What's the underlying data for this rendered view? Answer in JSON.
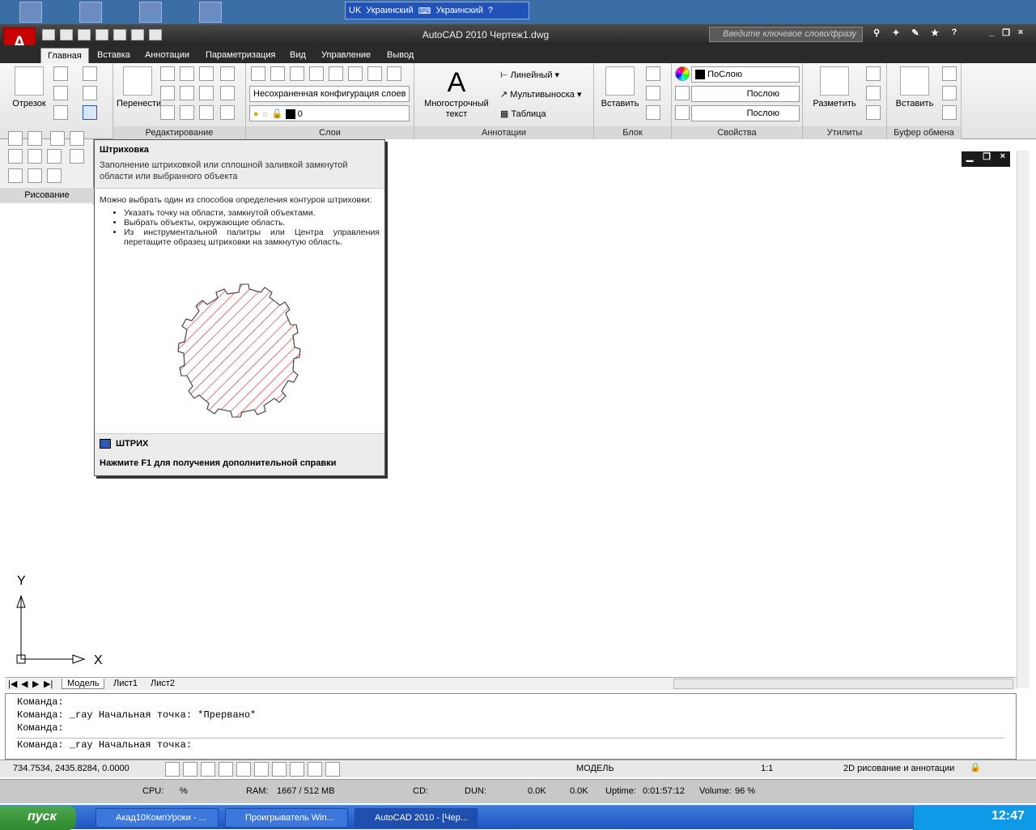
{
  "desktop": {
    "lang_indicator": "UK",
    "lang1": "Украинский",
    "lang2": "Украинский"
  },
  "window": {
    "title": "AutoCAD 2010 Чертеж1.dwg",
    "search_placeholder": "Введите ключевое слово/фразу"
  },
  "tabs": [
    "Главная",
    "Вставка",
    "Аннотации",
    "Параметризация",
    "Вид",
    "Управление",
    "Вывод"
  ],
  "ribbon": {
    "draw": {
      "line": "Отрезок"
    },
    "modify": {
      "move": "Перенести",
      "title": "Редактирование"
    },
    "layers": {
      "config": "Несохраненная конфигурация слоев",
      "current": "0",
      "title": "Слои"
    },
    "annotation": {
      "mtext": "Многострочный\nтекст",
      "linear": "Линейный",
      "mleader": "Мультивыноска",
      "table": "Таблица",
      "title": "Аннотации"
    },
    "block": {
      "insert": "Вставить",
      "title": "Блок"
    },
    "properties": {
      "color": "ПоСлою",
      "linetype": "Послою",
      "lineweight": "Послою",
      "title": "Свойства"
    },
    "utilities": {
      "measure": "Разметить",
      "title": "Утилиты"
    },
    "clipboard": {
      "paste": "Вставить",
      "title": "Буфер обмена"
    }
  },
  "draw_panel_title": "Рисование",
  "tooltip": {
    "title": "Штриховка",
    "desc": "Заполнение штриховкой или сплошной заливкой замкнутой области или выбранного объекта",
    "intro": "Можно выбрать один из способов определения контуров штриховки:",
    "items": [
      "Указать точку на области, замкнутой объектами.",
      "Выбрать объекты, окружающие область.",
      "Из инструментальной палитры или Центра управления перетащите образец штриховки на замкнутую область."
    ],
    "command": "ШТРИХ",
    "help": "Нажмите F1 для получения дополнительной справки"
  },
  "ucs": {
    "x": "X",
    "y": "Y"
  },
  "layout_tabs": [
    "Модель",
    "Лист1",
    "Лист2"
  ],
  "command_lines": [
    "Команда:",
    "Команда: _ray Начальная точка: *Прервано*",
    "Команда:",
    "Команда: _ray Начальная точка:"
  ],
  "status": {
    "coords": "734.7534, 2435.8284, 0.0000",
    "model": "МОДЕЛЬ",
    "scale": "1:1",
    "workspace": "2D рисование и аннотации"
  },
  "sysmon": {
    "cpu": "CPU:",
    "cpu_val": "%",
    "ram": "RAM:",
    "ram_val": "1667 / 512 MB",
    "cd": "CD:",
    "dun": "DUN:",
    "rx": "0.0K",
    "tx": "0.0K",
    "uptime_label": "Uptime:",
    "uptime": "0:01:57:12",
    "volume": "Volume:",
    "volume_val": "96 %"
  },
  "taskbar": {
    "start": "пуск",
    "tasks": [
      "Акад10КомпУроки - ...",
      "Проигрыватель Win...",
      "AutoCAD 2010 - [Чер..."
    ],
    "time": "12:47"
  }
}
